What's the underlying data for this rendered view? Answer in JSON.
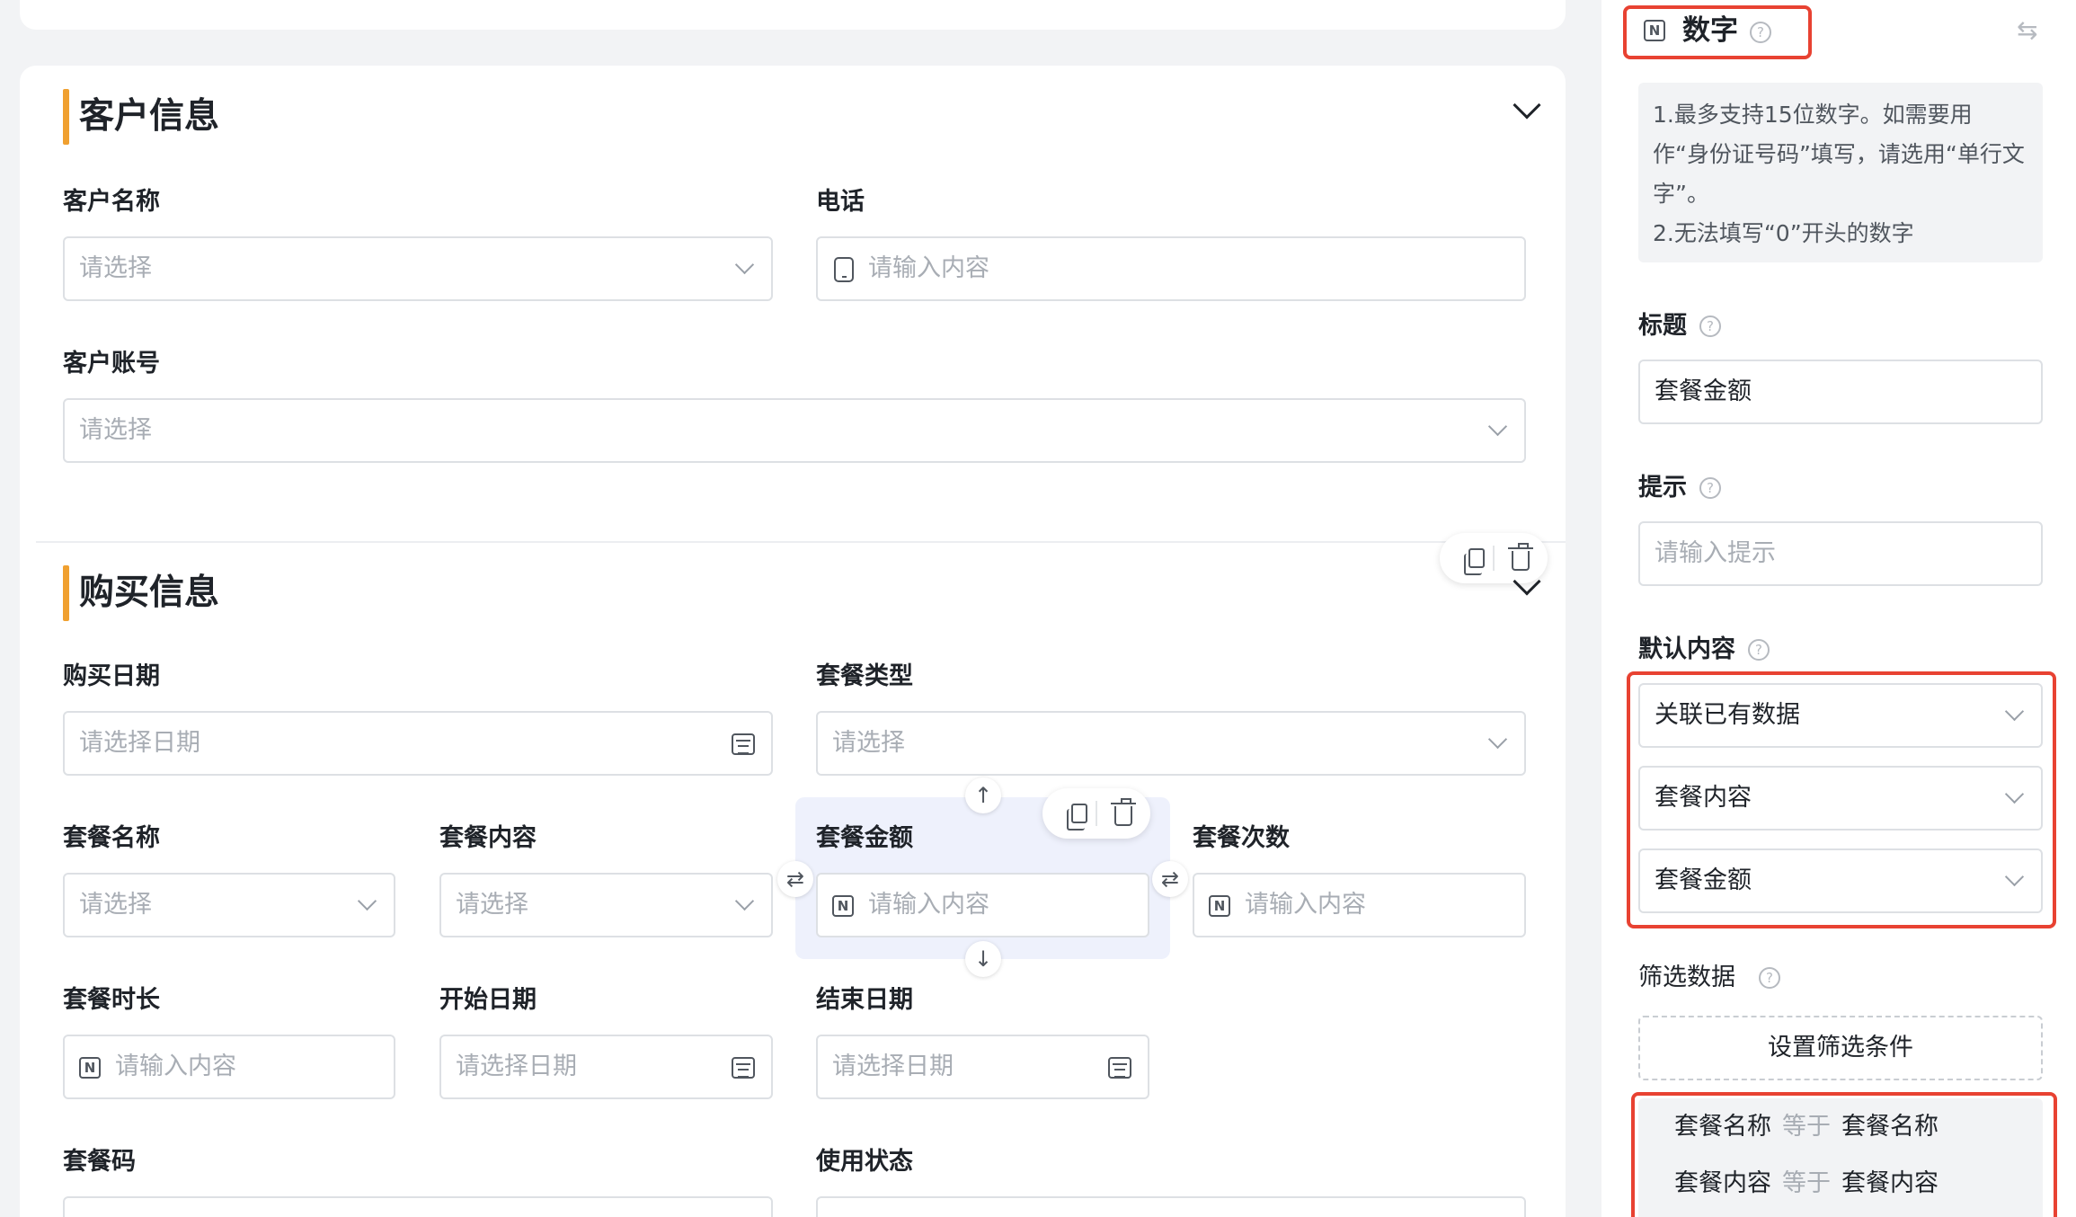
{
  "form": {
    "customer_section": {
      "title": "客户信息",
      "fields": {
        "customer_name": {
          "label": "客户名称",
          "placeholder": "请选择"
        },
        "phone": {
          "label": "电话",
          "placeholder": "请输入内容"
        },
        "customer_account": {
          "label": "客户账号",
          "placeholder": "请选择"
        }
      }
    },
    "purchase_section": {
      "title": "购买信息",
      "fields": {
        "purchase_date": {
          "label": "购买日期",
          "placeholder": "请选择日期"
        },
        "package_type": {
          "label": "套餐类型",
          "placeholder": "请选择"
        },
        "package_name": {
          "label": "套餐名称",
          "placeholder": "请选择"
        },
        "package_content": {
          "label": "套餐内容",
          "placeholder": "请选择"
        },
        "package_amount": {
          "label": "套餐金额",
          "placeholder": "请输入内容"
        },
        "package_count": {
          "label": "套餐次数",
          "placeholder": "请输入内容"
        },
        "package_duration": {
          "label": "套餐时长",
          "placeholder": "请输入内容"
        },
        "start_date": {
          "label": "开始日期",
          "placeholder": "请选择日期"
        },
        "end_date": {
          "label": "结束日期",
          "placeholder": "请选择日期"
        },
        "package_code": {
          "label": "套餐码",
          "placeholder": ""
        },
        "usage_status": {
          "label": "使用状态",
          "placeholder": ""
        }
      }
    }
  },
  "panel": {
    "field_type": "数字",
    "field_type_icon": "N",
    "description": [
      "1.最多支持15位数字。如需要用作“身份证号码”填写，请选用“单行文字”。",
      "2.无法填写“0”开头的数字"
    ],
    "title": {
      "label": "标题",
      "value": "套餐金额"
    },
    "hint": {
      "label": "提示",
      "placeholder": "请输入提示"
    },
    "default_content": {
      "label": "默认内容",
      "mode": "关联已有数据",
      "source_field": "套餐内容",
      "target_field": "套餐金额"
    },
    "filter": {
      "label": "筛选数据",
      "button": "设置筛选条件",
      "conditions": [
        {
          "field": "套餐名称",
          "operator": "等于",
          "value": "套餐名称"
        },
        {
          "field": "套餐内容",
          "operator": "等于",
          "value": "套餐内容"
        }
      ]
    },
    "help_glyph": "?",
    "swap_glyph": "⇆"
  },
  "glyphs": {
    "up": "↑",
    "down": "↓",
    "swap": "⇄",
    "n": "N"
  },
  "colors": {
    "accent_bar": "#f0a030",
    "annotation_red": "#e84232",
    "selected_bg": "#eef1fc"
  }
}
